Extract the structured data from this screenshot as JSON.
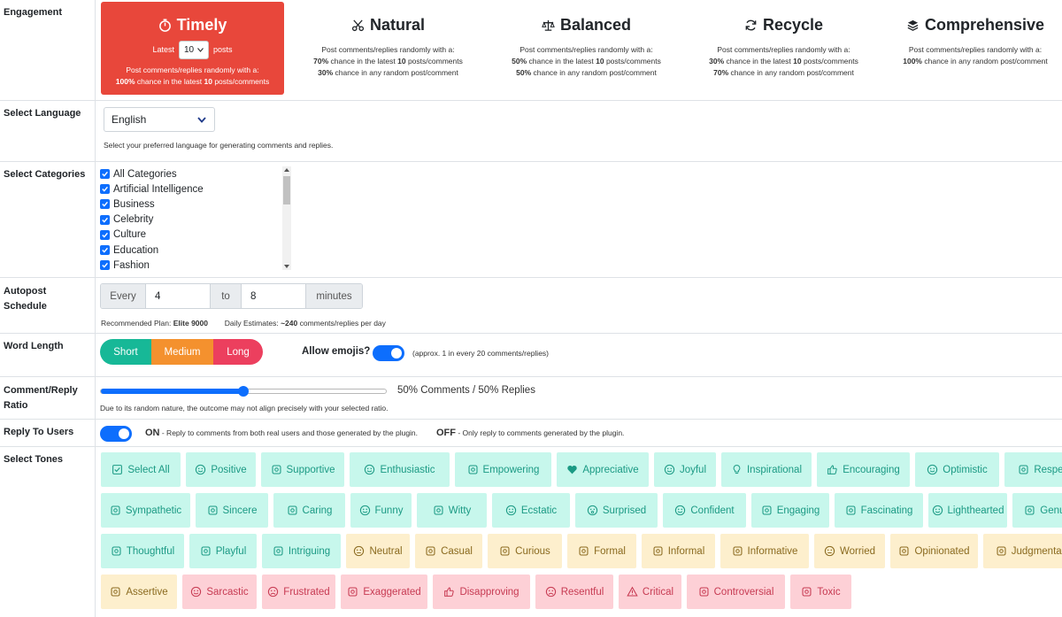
{
  "labels": {
    "engagement": "Engagement",
    "language": "Select Language",
    "categories": "Select Categories",
    "autopost": "Autopost Schedule",
    "word_length": "Word Length",
    "ratio": "Comment/Reply Ratio",
    "reply_users": "Reply To Users",
    "tones": "Select Tones"
  },
  "engagement": {
    "timely": {
      "title": "Timely",
      "latest_prefix": "Latest",
      "latest_value": "10",
      "latest_suffix": "posts",
      "line1": "Post comments/replies randomly with a:",
      "line2a": "100%",
      "line2b": " chance in the latest ",
      "line2c": "10",
      "line2d": " posts/comments"
    },
    "natural": {
      "title": "Natural",
      "line1": "Post comments/replies randomly with a:",
      "p1": "70%",
      "t1": " chance in the latest ",
      "n1": "10",
      "t1b": " posts/comments",
      "p2": "30%",
      "t2": " chance in any random post/comment"
    },
    "balanced": {
      "title": "Balanced",
      "line1": "Post comments/replies randomly with a:",
      "p1": "50%",
      "t1": " chance in the latest ",
      "n1": "10",
      "t1b": " posts/comments",
      "p2": "50%",
      "t2": " chance in any random post/comment"
    },
    "recycle": {
      "title": "Recycle",
      "line1": "Post comments/replies randomly with a:",
      "p1": "30%",
      "t1": " chance in the latest ",
      "n1": "10",
      "t1b": " posts/comments",
      "p2": "70%",
      "t2": " chance in any random post/comment"
    },
    "comprehensive": {
      "title": "Comprehensive",
      "line1": "Post comments/replies randomly with a:",
      "p1": "100%",
      "t1": " chance in any random post/comment"
    }
  },
  "language": {
    "value": "English",
    "help": "Select your preferred language for generating comments and replies."
  },
  "categories": [
    "All Categories",
    "Artificial Intelligence",
    "Business",
    "Celebrity",
    "Culture",
    "Education",
    "Fashion"
  ],
  "autopost": {
    "every": "Every",
    "from": "4",
    "to": "to",
    "until": "8",
    "unit": "minutes",
    "plan_label": "Recommended Plan:",
    "plan": "Elite 9000",
    "est_label": "Daily Estimates:",
    "est_value": "~240",
    "est_suffix": "comments/replies per day"
  },
  "word_length": {
    "short": "Short",
    "medium": "Medium",
    "long": "Long",
    "emoji_label": "Allow emojis?",
    "emoji_note": "(approx. 1 in every 20 comments/replies)"
  },
  "ratio": {
    "value": 50,
    "text": "50% Comments / 50% Replies",
    "note": "Due to its random nature, the outcome may not align precisely with your selected ratio."
  },
  "reply_users": {
    "on": "ON",
    "on_text": " - Reply to comments from both real users and those generated by the plugin.",
    "off": "OFF",
    "off_text": " - Only reply to comments generated by the plugin."
  },
  "tones": [
    {
      "label": "Select All",
      "icon": "check-square-icon",
      "kind": "pos"
    },
    {
      "label": "Positive",
      "icon": "smile-icon",
      "kind": "pos"
    },
    {
      "label": "Supportive",
      "icon": "hands-icon",
      "kind": "pos"
    },
    {
      "label": "Enthusiastic",
      "icon": "grin-icon",
      "kind": "pos"
    },
    {
      "label": "Empowering",
      "icon": "fist-icon",
      "kind": "pos"
    },
    {
      "label": "Appreciative",
      "icon": "heart-icon",
      "kind": "pos"
    },
    {
      "label": "Joyful",
      "icon": "laugh-icon",
      "kind": "pos"
    },
    {
      "label": "Inspirational",
      "icon": "bulb-icon",
      "kind": "pos"
    },
    {
      "label": "Encouraging",
      "icon": "thumbs-up-icon",
      "kind": "pos"
    },
    {
      "label": "Optimistic",
      "icon": "smile-beam-icon",
      "kind": "pos"
    },
    {
      "label": "Respectful",
      "icon": "handshake-icon",
      "kind": "pos"
    },
    {
      "label": "Sympathetic",
      "icon": "hands-helping-icon",
      "kind": "pos"
    },
    {
      "label": "Sincere",
      "icon": "person-icon",
      "kind": "pos"
    },
    {
      "label": "Caring",
      "icon": "hand-holding-heart-icon",
      "kind": "pos"
    },
    {
      "label": "Funny",
      "icon": "laugh-squint-icon",
      "kind": "pos"
    },
    {
      "label": "Witty",
      "icon": "mug-icon",
      "kind": "pos"
    },
    {
      "label": "Ecstatic",
      "icon": "grin-stars-icon",
      "kind": "pos"
    },
    {
      "label": "Surprised",
      "icon": "surprise-icon",
      "kind": "pos"
    },
    {
      "label": "Confident",
      "icon": "smile-wink-icon",
      "kind": "pos"
    },
    {
      "label": "Engaging",
      "icon": "people-icon",
      "kind": "pos"
    },
    {
      "label": "Fascinating",
      "icon": "glasses-icon",
      "kind": "pos"
    },
    {
      "label": "Lighthearted",
      "icon": "smile-icon",
      "kind": "pos"
    },
    {
      "label": "Genuine",
      "icon": "apple-icon",
      "kind": "pos"
    },
    {
      "label": "Thoughtful",
      "icon": "compass-icon",
      "kind": "pos"
    },
    {
      "label": "Playful",
      "icon": "paper-plane-icon",
      "kind": "pos"
    },
    {
      "label": "Intriguing",
      "icon": "mask-icon",
      "kind": "pos"
    },
    {
      "label": "Neutral",
      "icon": "meh-icon",
      "kind": "neu"
    },
    {
      "label": "Casual",
      "icon": "cocktail-icon",
      "kind": "neu"
    },
    {
      "label": "Curious",
      "icon": "question-icon",
      "kind": "neu"
    },
    {
      "label": "Formal",
      "icon": "document-icon",
      "kind": "neu"
    },
    {
      "label": "Informal",
      "icon": "shirt-icon",
      "kind": "neu"
    },
    {
      "label": "Informative",
      "icon": "graduation-cap-icon",
      "kind": "neu"
    },
    {
      "label": "Worried",
      "icon": "grimace-icon",
      "kind": "neu"
    },
    {
      "label": "Opinionated",
      "icon": "comment-dots-icon",
      "kind": "neu"
    },
    {
      "label": "Judgmental",
      "icon": "gavel-icon",
      "kind": "neu"
    },
    {
      "label": "Assertive",
      "icon": "hand-icon",
      "kind": "neu"
    },
    {
      "label": "Sarcastic",
      "icon": "smirk-icon",
      "kind": "neg"
    },
    {
      "label": "Frustrated",
      "icon": "frown-icon",
      "kind": "neg"
    },
    {
      "label": "Exaggerated",
      "icon": "megaphone-icon",
      "kind": "neg"
    },
    {
      "label": "Disapproving",
      "icon": "thumbs-down-icon",
      "kind": "neg"
    },
    {
      "label": "Resentful",
      "icon": "angry-icon",
      "kind": "neg"
    },
    {
      "label": "Critical",
      "icon": "warning-icon",
      "kind": "neg"
    },
    {
      "label": "Controversial",
      "icon": "fire-icon",
      "kind": "neg"
    },
    {
      "label": "Toxic",
      "icon": "skull-icon",
      "kind": "neg"
    }
  ],
  "colors": {
    "timely_bg": "#e8473b",
    "primary": "#0d6efd",
    "short": "#17b897",
    "medium": "#f4912e",
    "long": "#ec3f5e"
  }
}
